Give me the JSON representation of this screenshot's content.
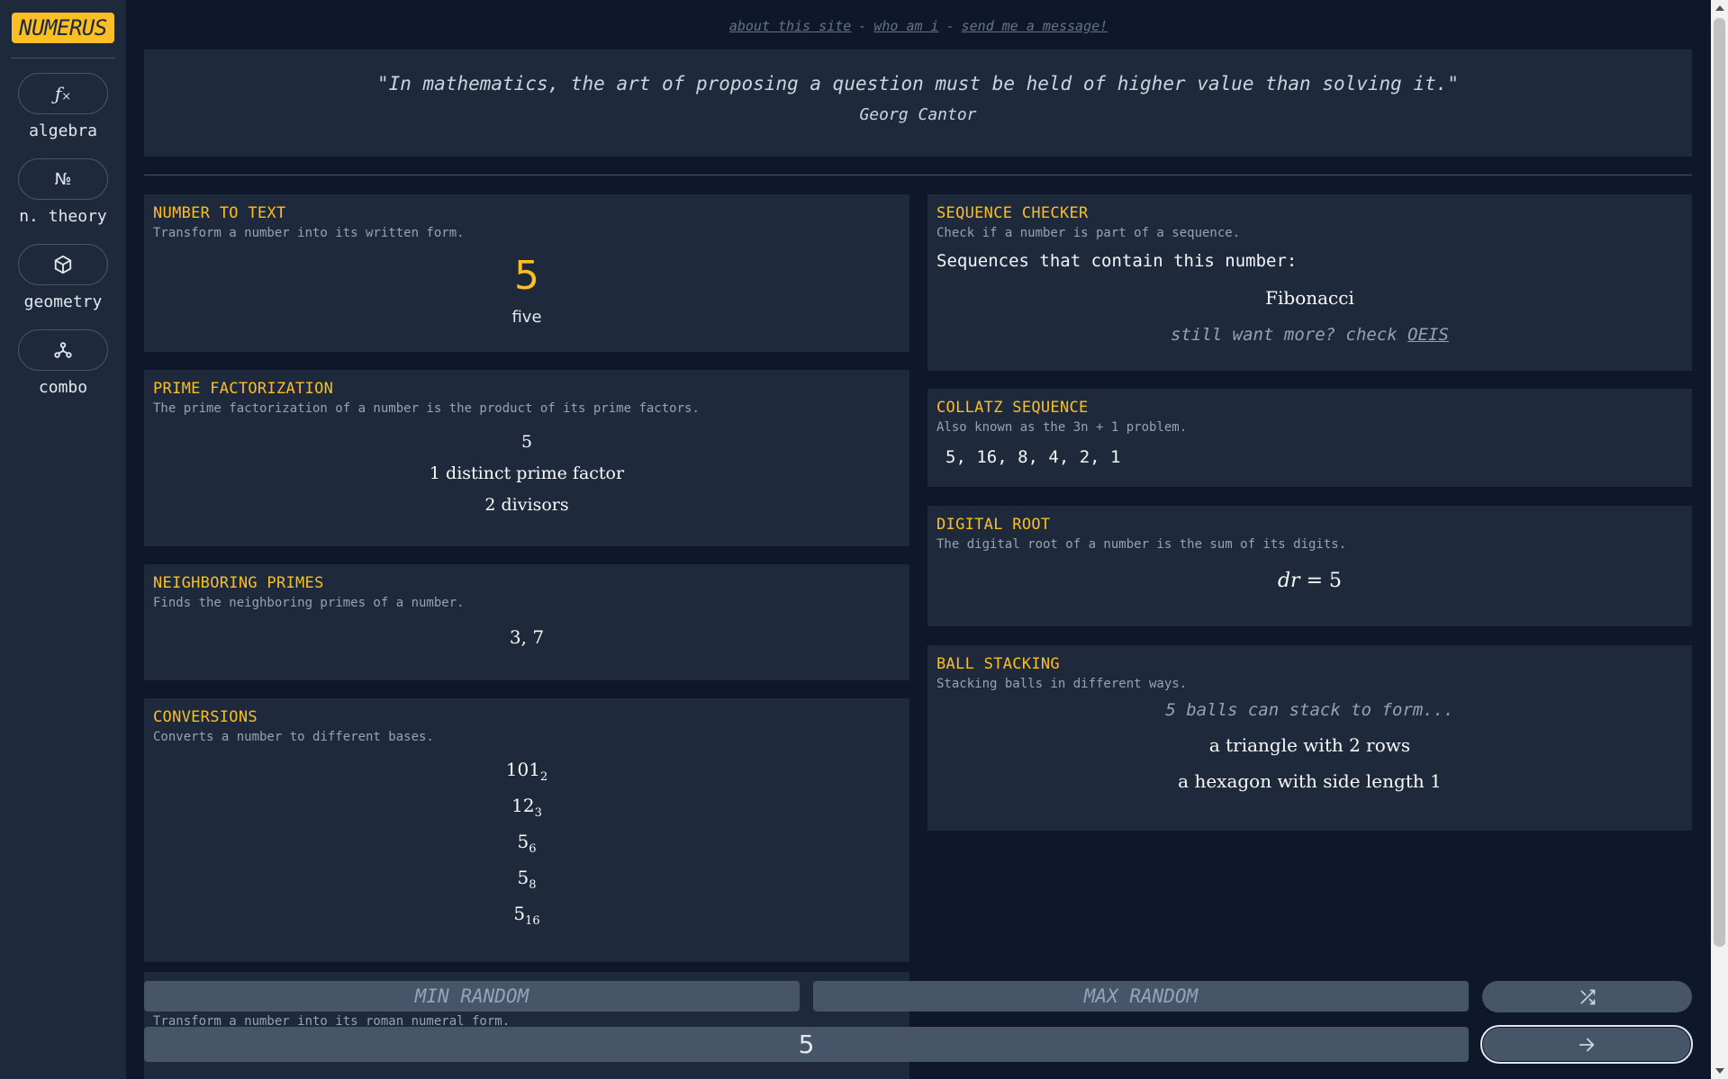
{
  "sidebar": {
    "logo": "NUMERUS",
    "items": [
      {
        "icon": "fx",
        "label": "algebra"
      },
      {
        "icon": "№",
        "label": "n. theory"
      },
      {
        "icon": "cube",
        "label": "geometry"
      },
      {
        "icon": "nodes",
        "label": "combo"
      }
    ]
  },
  "toplinks": {
    "about": "about this site",
    "whoami": "who am i",
    "message": "send me a message!",
    "sep": "-"
  },
  "quote": {
    "text": "\"In mathematics, the art of proposing a question must be held of higher value than solving it.\"",
    "author": "Georg Cantor"
  },
  "cards": {
    "number_to_text": {
      "title": "NUMBER TO TEXT",
      "desc": "Transform a number into its written form.",
      "number": "5",
      "word": "five"
    },
    "prime_factorization": {
      "title": "PRIME FACTORIZATION",
      "desc": "The prime factorization of a number is the product of its prime factors.",
      "factorization": "5",
      "distinct": "1 distinct prime factor",
      "divisors": "2 divisors"
    },
    "neighboring_primes": {
      "title": "NEIGHBORING PRIMES",
      "desc": "Finds the neighboring primes of a number.",
      "value": "3, 7"
    },
    "conversions": {
      "title": "CONVERSIONS",
      "desc": "Converts a number to different bases.",
      "items": [
        {
          "value": "101",
          "base": "2"
        },
        {
          "value": "12",
          "base": "3"
        },
        {
          "value": "5",
          "base": "6"
        },
        {
          "value": "5",
          "base": "8"
        },
        {
          "value": "5",
          "base": "16"
        }
      ]
    },
    "sequence_checker": {
      "title": "SEQUENCE CHECKER",
      "desc": "Check if a number is part of a sequence.",
      "heading": "Sequences that contain this number:",
      "sequence": "Fibonacci",
      "more_prefix": "still want more? check",
      "more_link": "OEIS"
    },
    "collatz": {
      "title": "COLLATZ SEQUENCE",
      "desc": "Also known as the 3n + 1 problem.",
      "value": "5, 16, 8, 4, 2, 1"
    },
    "digital_root": {
      "title": "DIGITAL ROOT",
      "desc": "The digital root of a number is the sum of its digits.",
      "lhs": "dr",
      "eq": "=",
      "value": "5"
    },
    "ball_stacking": {
      "title": "BALL STACKING",
      "desc": "Stacking balls in different ways.",
      "intro": "5 balls can stack to form...",
      "triangle": "a triangle with 2 rows",
      "hexagon": "a hexagon with side length 1"
    },
    "roman_partial": {
      "desc": "Transform a number into its roman numeral form."
    }
  },
  "controls": {
    "min_placeholder": "MIN RANDOM",
    "max_placeholder": "MAX RANDOM",
    "number_value": "5"
  }
}
